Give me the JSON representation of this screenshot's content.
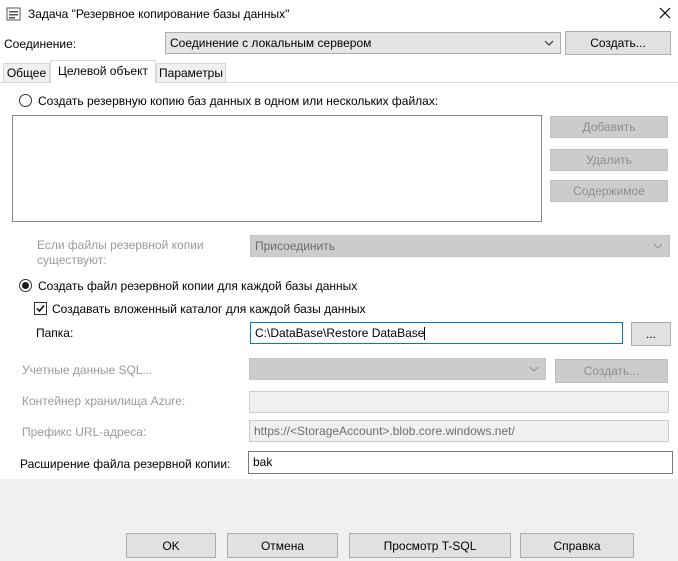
{
  "window": {
    "title": "Задача \"Резервное копирование базы данных\""
  },
  "connection": {
    "label": "Соединение:",
    "value": "Соединение с локальным сервером",
    "create_button": "Создать..."
  },
  "tabs": [
    {
      "label": "Общее"
    },
    {
      "label": "Целевой объект"
    },
    {
      "label": "Параметры"
    }
  ],
  "destination": {
    "radio_files_label": "Создать резервную копию баз данных в одном или нескольких файлах:",
    "files_list": [],
    "add_button": "Добавить",
    "remove_button": "Удалить",
    "contents_button": "Содержимое",
    "if_exists_label_line1": "Если файлы резервной копии",
    "if_exists_label_line2": "существуют:",
    "if_exists_value": "Присоединить",
    "radio_per_db_label": "Создать файл резервной копии для каждой базы данных",
    "subfolder_checkbox_label": "Создавать вложенный каталог для каждой базы данных",
    "folder_label": "Папка:",
    "folder_value": "C:\\DataBase\\Restore DataBase",
    "browse_button": "...",
    "sql_credential_label": "Учетные данные SQL...",
    "sql_credential_value": "",
    "sql_create_button": "Создать...",
    "azure_container_label": "Контейнер хранилища Azure:",
    "azure_container_value": "",
    "url_prefix_label": "Префикс URL-адреса:",
    "url_prefix_value": "https://<StorageAccount>.blob.core.windows.net/",
    "extension_label": "Расширение файла резервной копии:",
    "extension_value": "bak"
  },
  "footer": {
    "ok": "OK",
    "cancel": "Отмена",
    "view_tsql": "Просмотр T-SQL",
    "help": "Справка"
  },
  "state": {
    "selected_tab": "Целевой объект",
    "per_db_selected": true,
    "create_subfolder_checked": true
  }
}
